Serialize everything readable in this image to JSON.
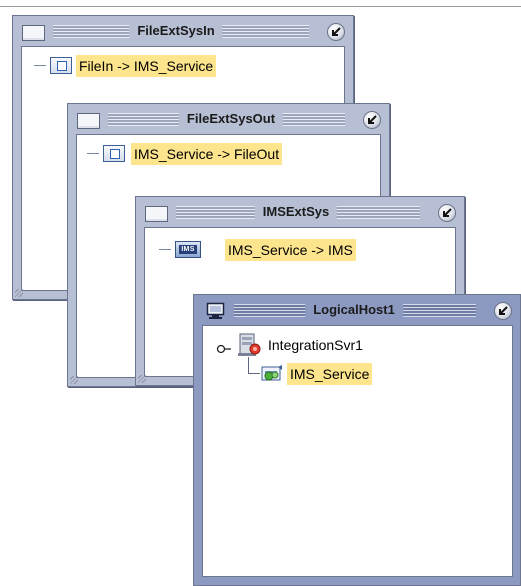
{
  "windows": [
    {
      "title": "FileExtSysIn",
      "node": "FileIn -> IMS_Service"
    },
    {
      "title": "FileExtSysOut",
      "node": "IMS_Service -> FileOut"
    },
    {
      "title": "IMSExtSys",
      "node": "IMS_Service -> IMS",
      "icon_text": "IMS"
    },
    {
      "title": "LogicalHost1",
      "server": "IntegrationSvr1",
      "service": "IMS_Service"
    }
  ],
  "colors": {
    "window_frame": "#b6bfd3",
    "active_frame": "#8c9ac1",
    "highlight": "#fde58e"
  },
  "icons": [
    "window-box-icon",
    "minimize-icon",
    "component-icon",
    "ims-icon",
    "monitor-icon",
    "server-icon",
    "service-icon",
    "pin-icon"
  ]
}
